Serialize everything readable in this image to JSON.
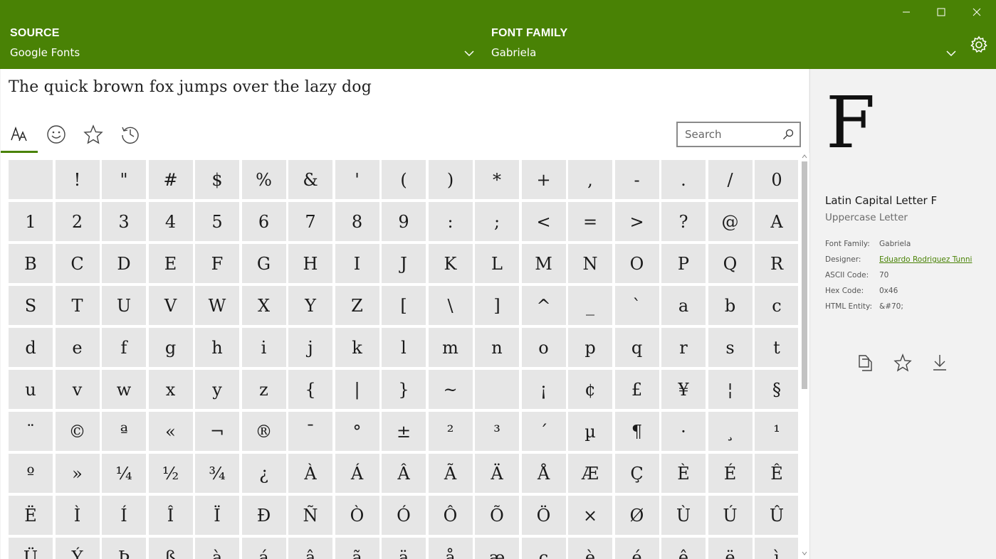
{
  "header": {
    "source_label": "SOURCE",
    "source_value": "Google Fonts",
    "family_label": "FONT FAMILY",
    "family_value": "Gabriela"
  },
  "sample_text": "The quick brown fox jumps over the lazy dog",
  "search": {
    "placeholder": "Search"
  },
  "tabs": [
    "font-glyphs-icon",
    "emoji-icon",
    "favorites-star-icon",
    "history-icon"
  ],
  "glyphs": [
    " ",
    "!",
    "\"",
    "#",
    "$",
    "%",
    "&",
    "'",
    "(",
    ")",
    "*",
    "+",
    ",",
    "-",
    ".",
    "/",
    "0",
    "1",
    "2",
    "3",
    "4",
    "5",
    "6",
    "7",
    "8",
    "9",
    ":",
    ";",
    "<",
    "=",
    ">",
    "?",
    "@",
    "A",
    "B",
    "C",
    "D",
    "E",
    "F",
    "G",
    "H",
    "I",
    "J",
    "K",
    "L",
    "M",
    "N",
    "O",
    "P",
    "Q",
    "R",
    "S",
    "T",
    "U",
    "V",
    "W",
    "X",
    "Y",
    "Z",
    "[",
    "\\",
    "]",
    "^",
    "_",
    "`",
    "a",
    "b",
    "c",
    "d",
    "e",
    "f",
    "g",
    "h",
    "i",
    "j",
    "k",
    "l",
    "m",
    "n",
    "o",
    "p",
    "q",
    "r",
    "s",
    "t",
    "u",
    "v",
    "w",
    "x",
    "y",
    "z",
    "{",
    "|",
    "}",
    "~",
    " ",
    "¡",
    "¢",
    "£",
    "¥",
    "¦",
    "§",
    "¨",
    "©",
    "ª",
    "«",
    "¬",
    "®",
    "¯",
    "°",
    "±",
    "²",
    "³",
    "´",
    "µ",
    "¶",
    "·",
    "¸",
    "¹",
    "º",
    "»",
    "¼",
    "½",
    "¾",
    "¿",
    "À",
    "Á",
    "Â",
    "Ã",
    "Ä",
    "Å",
    "Æ",
    "Ç",
    "È",
    "É",
    "Ê",
    "Ë",
    "Ì",
    "Í",
    "Î",
    "Ï",
    "Ð",
    "Ñ",
    "Ò",
    "Ó",
    "Ô",
    "Õ",
    "Ö",
    "×",
    "Ø",
    "Ù",
    "Ú",
    "Û",
    "Ü",
    "Ý",
    "Þ",
    "ß",
    "à",
    "á",
    "â",
    "ã",
    "ä",
    "å",
    "æ",
    "ç",
    "è",
    "é",
    "ê",
    "ë",
    "ì"
  ],
  "selected": {
    "glyph": "F",
    "name": "Latin Capital Letter F",
    "category": "Uppercase Letter",
    "details": [
      {
        "key": "Font Family:",
        "value": "Gabriela",
        "link": false
      },
      {
        "key": "Designer:",
        "value": "Eduardo Rodriguez Tunni",
        "link": true
      },
      {
        "key": "ASCII Code:",
        "value": "70",
        "link": false
      },
      {
        "key": "Hex Code:",
        "value": "0x46",
        "link": false
      },
      {
        "key": "HTML Entity:",
        "value": "&#70;",
        "link": false
      }
    ]
  },
  "colors": {
    "accent": "#498205"
  }
}
